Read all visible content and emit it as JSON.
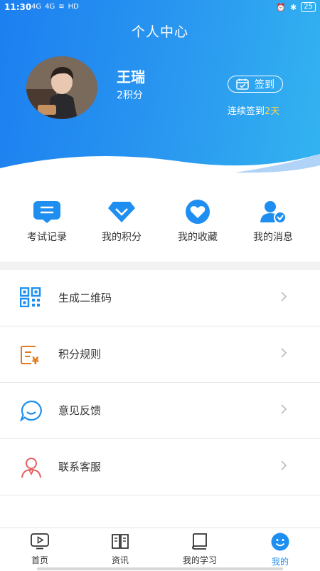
{
  "status_bar": {
    "time": "11:30",
    "net1": "4G",
    "net2": "4G",
    "hd": "HD",
    "battery": "25"
  },
  "header": {
    "title": "个人中心"
  },
  "user": {
    "name": "王瑞",
    "points": "2积分"
  },
  "sign_in": {
    "label": "签到",
    "streak_prefix": "连续签到",
    "streak_days": "2天"
  },
  "quick_actions": [
    {
      "label": "考试记录",
      "icon": "exam-record-icon"
    },
    {
      "label": "我的积分",
      "icon": "diamond-icon"
    },
    {
      "label": "我的收藏",
      "icon": "heart-icon"
    },
    {
      "label": "我的消息",
      "icon": "user-check-icon"
    }
  ],
  "menu": [
    {
      "label": "生成二维码",
      "icon": "qr-code-icon"
    },
    {
      "label": "积分规则",
      "icon": "points-rule-icon"
    },
    {
      "label": "意见反馈",
      "icon": "feedback-icon"
    },
    {
      "label": "联系客服",
      "icon": "customer-service-icon"
    }
  ],
  "tabs": [
    {
      "label": "首页",
      "icon": "play-icon"
    },
    {
      "label": "资讯",
      "icon": "book-open-icon"
    },
    {
      "label": "我的学习",
      "icon": "book-icon"
    },
    {
      "label": "我的",
      "icon": "smiley-icon",
      "active": true
    }
  ],
  "colors": {
    "primary": "#1e8ff0",
    "accent": "#ffd54f",
    "points_icon": "#e0791f",
    "service_icon": "#e35f5f"
  }
}
